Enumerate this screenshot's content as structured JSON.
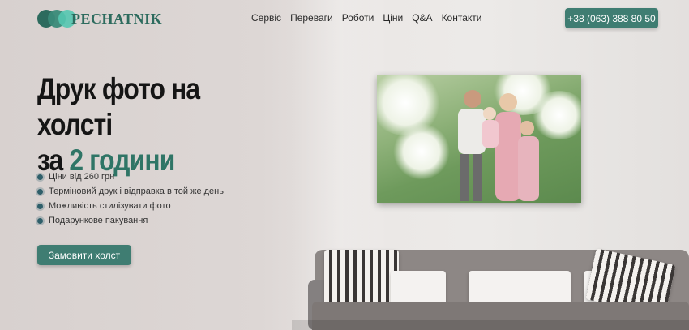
{
  "header": {
    "logo_text": "PECHATNIK",
    "nav": [
      "Сервіс",
      "Переваги",
      "Роботи",
      "Ціни",
      "Q&A",
      "Контакти"
    ],
    "phone": "+38 (063) 388 80 50"
  },
  "hero": {
    "title_line1": "Друк фото на холсті",
    "title_prefix": "за",
    "title_accent": "2 години",
    "features": [
      "Ціни від 260 грн",
      "Терміновий друк і відправка в той же день",
      "Можливість стилізувати фото",
      "Подарункове пакування"
    ],
    "cta": "Замовити холст"
  },
  "colors": {
    "accent": "#3f7d72",
    "title_accent": "#2f7566",
    "background": "#ddd8d6"
  },
  "icons": {
    "logo": "three-overlapping-circles",
    "bullet": "dot-icon"
  }
}
